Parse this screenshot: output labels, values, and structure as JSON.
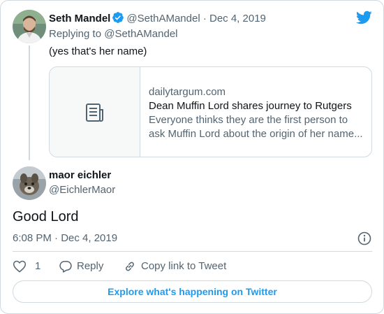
{
  "parent_tweet": {
    "display_name": "Seth Mandel",
    "handle": "@SethAMandel",
    "date": "Dec 4, 2019",
    "replying_to": "Replying to @SethAMandel",
    "text": "(yes that's her name)",
    "link_card": {
      "domain": "dailytargum.com",
      "title": "Dean Muffin Lord shares journey to Rutgers",
      "description_line1": "Everyone thinks they are the first person to",
      "description_line2": "ask Muffin Lord about the origin of her name..."
    }
  },
  "reply_tweet": {
    "display_name": "maor eichler",
    "handle": "@EichlerMaor",
    "text": "Good Lord",
    "timestamp": "6:08 PM · Dec 4, 2019"
  },
  "actions": {
    "like_count": "1",
    "reply_label": "Reply",
    "copy_link_label": "Copy link to Tweet"
  },
  "explore_button": "Explore what's happening on Twitter",
  "colors": {
    "twitter_blue": "#1d9bf0",
    "muted_text": "#536471",
    "border": "#cfd9de"
  },
  "icons": [
    "twitter-bird-icon",
    "verified-badge-icon",
    "article-icon",
    "info-icon",
    "heart-icon",
    "reply-bubble-icon",
    "link-icon"
  ]
}
